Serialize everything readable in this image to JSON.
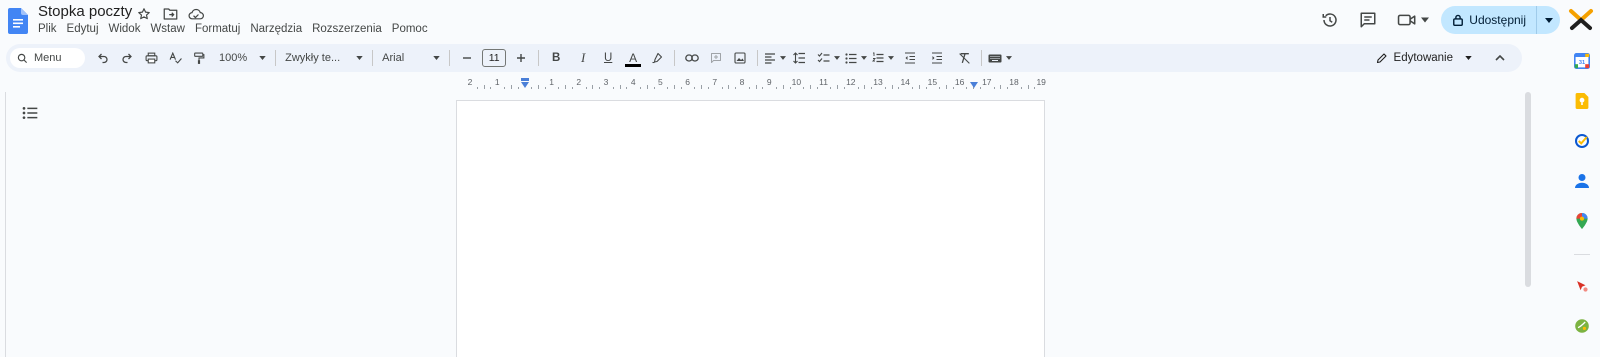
{
  "document": {
    "title": "Stopka poczty"
  },
  "menu": {
    "items": [
      "Plik",
      "Edytuj",
      "Widok",
      "Wstaw",
      "Formatuj",
      "Narzędzia",
      "Rozszerzenia",
      "Pomoc"
    ]
  },
  "header": {
    "share_label": "Udostępnij"
  },
  "toolbar": {
    "menu_search_label": "Menu",
    "zoom": "100%",
    "style": "Zwykły te...",
    "font": "Arial",
    "font_size": "11",
    "bold_label": "B",
    "italic_label": "I",
    "underline_label": "U",
    "text_color_label": "A",
    "text_color": "#000000",
    "mode_label": "Edytowanie"
  },
  "ruler": {
    "labels": [
      "2",
      "1",
      "",
      "1",
      "2",
      "3",
      "4",
      "5",
      "6",
      "7",
      "8",
      "9",
      "10",
      "11",
      "12",
      "13",
      "14",
      "15",
      "16",
      "17",
      "18",
      "19"
    ]
  },
  "colors": {
    "accent": "#0b57d0",
    "share_bg": "#c2e7ff",
    "toolbar_bg": "#edf2fa",
    "page_bg": "#f9fbfd",
    "docs_blue": "#4285f4"
  },
  "sidepanel": {
    "icons": [
      "calendar-icon",
      "keep-icon",
      "tasks-icon",
      "contacts-icon",
      "maps-icon",
      "extension-icon",
      "extension-icon-2"
    ]
  }
}
